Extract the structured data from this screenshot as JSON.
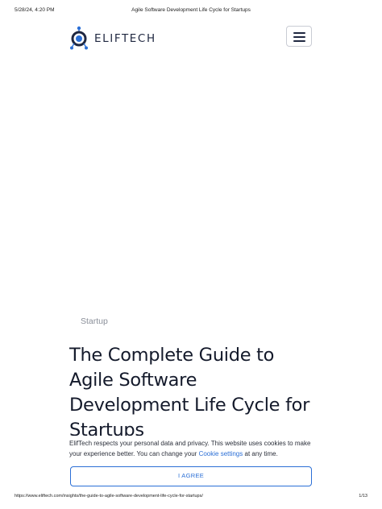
{
  "print_header": {
    "datetime": "5/28/24, 4:20 PM",
    "page_title": "Agile Software Development Life Cycle for Startups"
  },
  "header": {
    "logo_text": "ELIFTECH",
    "logo_icon": "eliftech-logo-icon",
    "menu_icon": "hamburger-menu-icon"
  },
  "article": {
    "category": "Startup",
    "title": "The Complete Guide to Agile Software Development Life Cycle for Startups"
  },
  "cookie_banner": {
    "text_before_link": "ElifTech respects your personal data and privacy. This website uses cookies to make your experience better. You can change your ",
    "link_text": "Cookie settings",
    "text_after_link": " at any time.",
    "agree_label": "I AGREE"
  },
  "print_footer": {
    "url": "https://www.eliftech.com/insights/the-guide-to-agile-software-development-life-cycle-for-startups/",
    "page_number": "1/13"
  },
  "colors": {
    "accent": "#2b6fd6",
    "text": "#141a2b",
    "muted": "#8a8f99"
  }
}
